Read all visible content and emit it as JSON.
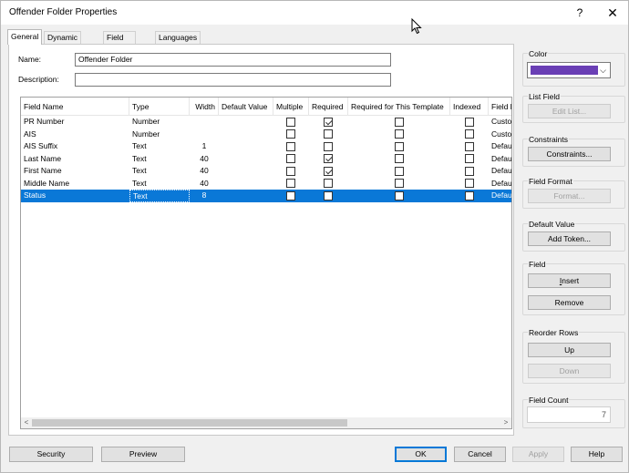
{
  "window": {
    "title": "Offender Folder Properties",
    "help_glyph": "?",
    "close_glyph": "✕"
  },
  "tabs": [
    {
      "label": "General",
      "active": true
    },
    {
      "label": "Dynamic Fields"
    },
    {
      "label": "Field Groups"
    },
    {
      "label": "Languages"
    }
  ],
  "general": {
    "name_label": "Name:",
    "name_value": "Offender Folder",
    "description_label": "Description:",
    "description_value": ""
  },
  "grid": {
    "headers": [
      "Field Name",
      "Type",
      "Width",
      "Default Value",
      "Multiple",
      "Required",
      "Required for This Template",
      "Indexed",
      "Field l"
    ],
    "rows": [
      {
        "name": "PR Number",
        "type": "Number",
        "width": "",
        "multiple": false,
        "required": true,
        "req_template": false,
        "indexed": false,
        "field_l": "Custo",
        "selected": false
      },
      {
        "name": "AIS",
        "type": "Number",
        "width": "",
        "multiple": false,
        "required": false,
        "req_template": false,
        "indexed": false,
        "field_l": "Custo",
        "selected": false
      },
      {
        "name": "AIS Suffix",
        "type": "Text",
        "width": "1",
        "multiple": false,
        "required": false,
        "req_template": false,
        "indexed": false,
        "field_l": "Defau",
        "selected": false
      },
      {
        "name": "Last Name",
        "type": "Text",
        "width": "40",
        "multiple": false,
        "required": true,
        "req_template": false,
        "indexed": false,
        "field_l": "Defau",
        "selected": false
      },
      {
        "name": "First Name",
        "type": "Text",
        "width": "40",
        "multiple": false,
        "required": true,
        "req_template": false,
        "indexed": false,
        "field_l": "Defau",
        "selected": false
      },
      {
        "name": "Middle Name",
        "type": "Text",
        "width": "40",
        "multiple": false,
        "required": false,
        "req_template": false,
        "indexed": false,
        "field_l": "Defau",
        "selected": false
      },
      {
        "name": "Status",
        "type": "Text",
        "width": "8",
        "multiple": false,
        "required": false,
        "req_template": false,
        "indexed": false,
        "field_l": "Defau",
        "selected": true
      }
    ],
    "scroll_left": "<",
    "scroll_right": ">"
  },
  "side": {
    "color": {
      "title": "Color",
      "value": "#6a3fb5"
    },
    "list_field": {
      "title": "List Field",
      "button": "Edit List..."
    },
    "constraints": {
      "title": "Constraints",
      "button": "Constraints..."
    },
    "field_format": {
      "title": "Field Format",
      "button": "Format..."
    },
    "default_value": {
      "title": "Default Value",
      "button": "Add Token..."
    },
    "field": {
      "title": "Field",
      "insert": "Insert",
      "remove": "Remove"
    },
    "reorder": {
      "title": "Reorder Rows",
      "up": "Up",
      "down": "Down"
    },
    "field_count": {
      "title": "Field Count",
      "value": "7"
    }
  },
  "footer": {
    "security": "Security",
    "preview": "Preview",
    "ok": "OK",
    "cancel": "Cancel",
    "apply": "Apply",
    "help": "Help"
  }
}
